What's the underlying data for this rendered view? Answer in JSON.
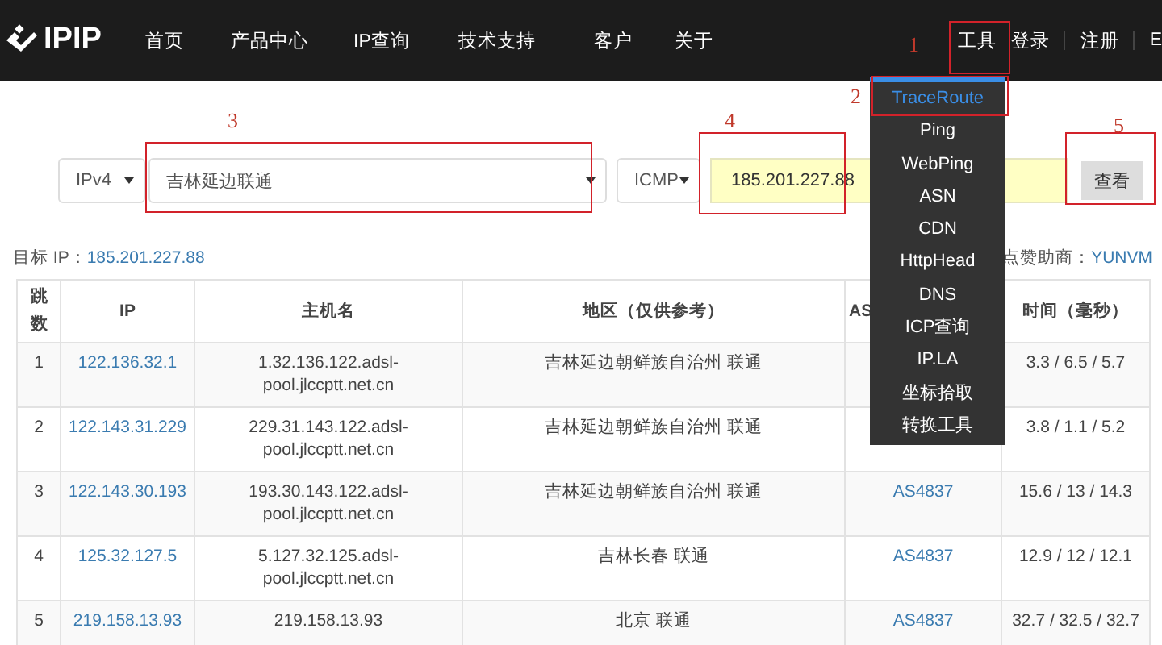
{
  "header": {
    "logo": "IPIP",
    "nav": [
      {
        "label": "首页"
      },
      {
        "label": "产品中心"
      },
      {
        "label": "IP查询"
      },
      {
        "label": "技术支持"
      },
      {
        "label": "客户"
      },
      {
        "label": "关于"
      }
    ],
    "right": [
      {
        "label": "工具"
      },
      {
        "label": "登录"
      },
      {
        "label": "注册"
      },
      {
        "label": "E"
      }
    ]
  },
  "tools_menu": [
    {
      "label": "TraceRoute",
      "selected": true
    },
    {
      "label": "Ping",
      "selected": false
    },
    {
      "label": "WebPing",
      "selected": false
    },
    {
      "label": "ASN",
      "selected": false
    },
    {
      "label": "CDN",
      "selected": false
    },
    {
      "label": "HttpHead",
      "selected": false
    },
    {
      "label": "DNS",
      "selected": false
    },
    {
      "label": "ICP查询",
      "selected": false
    },
    {
      "label": "IP.LA",
      "selected": false
    },
    {
      "label": "坐标拾取",
      "selected": false
    },
    {
      "label": "转换工具",
      "selected": false
    }
  ],
  "form": {
    "protocol_version": "IPv4",
    "node": "吉林延边联通",
    "method": "ICMP",
    "target": "185.201.227.88",
    "submit": "查看"
  },
  "target_line": {
    "label": "目标 IP：",
    "ip": "185.201.227.88",
    "sponsor": "点赞助商：",
    "sponsor_name": "YUNVM"
  },
  "table": {
    "columns": [
      "跳数",
      "IP",
      "主机名",
      "地区（仅供参考）",
      "AS",
      "时间（毫秒）"
    ],
    "rows": [
      {
        "hop": "1",
        "ip": "122.136.32.1",
        "host": "1.32.136.122.adsl-pool.jlccptt.net.cn",
        "region": "吉林延边朝鲜族自治州 联通",
        "time": "3.3 / 6.5 / 5.7"
      },
      {
        "hop": "2",
        "ip": "122.143.31.229",
        "host": "229.31.143.122.adsl-pool.jlccptt.net.cn",
        "region": "吉林延边朝鲜族自治州 联通",
        "time": "3.8 / 1.1 / 5.2"
      },
      {
        "hop": "3",
        "ip": "122.143.30.193",
        "host": "193.30.143.122.adsl-pool.jlccptt.net.cn",
        "region": "吉林延边朝鲜族自治州 联通",
        "asn": "AS4837",
        "time": "15.6 / 13 / 14.3"
      },
      {
        "hop": "4",
        "ip": "125.32.127.5",
        "host": "5.127.32.125.adsl-pool.jlccptt.net.cn",
        "region": "吉林长春 联通",
        "asn": "AS4837",
        "time": "12.9 / 12 / 12.1"
      },
      {
        "hop": "5",
        "ip": "219.158.13.93",
        "host": "219.158.13.93",
        "region": "北京 联通",
        "asn": "AS4837",
        "time": "32.7 / 32.5 / 32.7"
      }
    ]
  },
  "annotations": [
    {
      "label": "1"
    },
    {
      "label": "2"
    },
    {
      "label": "3"
    },
    {
      "label": "4"
    },
    {
      "label": "5"
    }
  ]
}
